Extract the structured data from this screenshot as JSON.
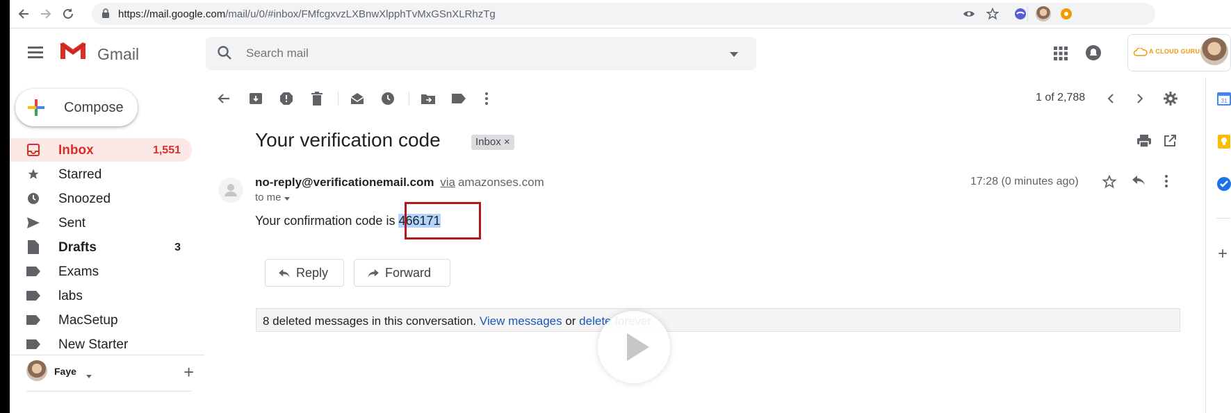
{
  "browser": {
    "url_host": "https://mail.google.com",
    "url_path": "/mail/u/0/#inbox/FMfcgxvzLXBnwXlpphTvMxGSnXLRhzTg"
  },
  "header": {
    "app_name": "Gmail",
    "search_placeholder": "Search mail",
    "org_badge_text": "A CLOUD GURU"
  },
  "sidebar": {
    "compose_label": "Compose",
    "items": [
      {
        "label": "Inbox",
        "count": "1,551",
        "icon": "inbox-icon",
        "active": true
      },
      {
        "label": "Starred",
        "count": "",
        "icon": "star-icon"
      },
      {
        "label": "Snoozed",
        "count": "",
        "icon": "clock-icon"
      },
      {
        "label": "Sent",
        "count": "",
        "icon": "send-icon"
      },
      {
        "label": "Drafts",
        "count": "3",
        "icon": "draft-icon",
        "bold": true
      },
      {
        "label": "Exams",
        "count": "",
        "icon": "label-icon"
      },
      {
        "label": "labs",
        "count": "",
        "icon": "label-icon"
      },
      {
        "label": "MacSetup",
        "count": "",
        "icon": "label-icon"
      },
      {
        "label": "New Starter",
        "count": "",
        "icon": "label-icon"
      }
    ],
    "hangouts_user": "Faye"
  },
  "toolbar": {
    "pager": "1 of 2,788"
  },
  "message": {
    "subject": "Your verification code",
    "label_chip": "Inbox ×",
    "sender_email": "no-reply@verificationemail.com",
    "via": "via",
    "via_domain": "amazonses.com",
    "to": "to me",
    "time": "17:28 (0 minutes ago)",
    "body_prefix": "Your confirmation code is ",
    "code": "466171",
    "reply_label": "Reply",
    "forward_label": "Forward",
    "deleted_notice": "8 deleted messages in this conversation.",
    "view_messages": "View messages",
    "or_text": " or ",
    "delete_forever": "delete forever",
    "period": "."
  },
  "colors": {
    "accent_red": "#d93025",
    "link_blue": "#1a57b8",
    "highlight_box": "#b0191e"
  }
}
